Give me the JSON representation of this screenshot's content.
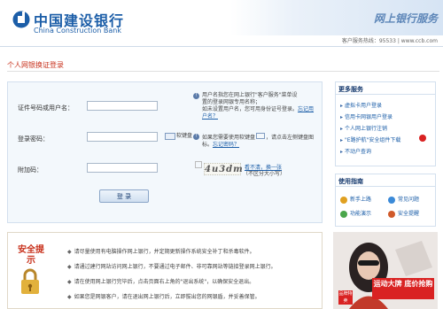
{
  "header": {
    "logo_cn": "中国建设银行",
    "logo_en": "China Construction Bank",
    "banner_title": "网上银行服务",
    "hotline": "客户服务热线：95533  |  www.ccb.com"
  },
  "page_title": "个人网银换证登录",
  "login": {
    "username_label": "证件号码或用户名：",
    "username_value": "",
    "password_label": "登录密码：",
    "password_value": "",
    "captcha_label": "附加码：",
    "captcha_value": "",
    "captcha_image_text": "4u3dm",
    "captcha_refresh_link": "看不清，换一张",
    "captcha_case_note": "（不区分大小写）",
    "keyboard_label": "软键盘",
    "username_hint_1": "用户名指您在网上银行\"客户服务\"菜单设",
    "username_hint_2": "置的登录网银专用名称；",
    "username_hint_3": "如未设置用户名，您可用身份证号登录。",
    "username_hint_link": "忘记用户名？",
    "password_hint_1": "如果您需要使用软键盘",
    "password_hint_2": "，请点击左侧键盘图标。",
    "password_hint_link": "忘记密码？",
    "login_button": "登 录"
  },
  "more_services": {
    "title": "更多服务",
    "items": [
      "虚拟卡用户登录",
      "信用卡网银用户登录",
      "个人网上银行注销",
      "\"E路护航\"安全组件下载",
      "不动户查询"
    ]
  },
  "guide": {
    "title": "使用指南",
    "items": [
      "新手上路",
      "常见问题",
      "功能演示",
      "安全提醒"
    ]
  },
  "security": {
    "title": "安全提示",
    "tips": [
      "请尽量使用有电脑操作网上银行，并定期更新操作系统安全补丁和杀毒软件。",
      "请通过建行网站访问网上银行，不要通过电子邮件、非可靠网站等链接登录网上银行。",
      "请在使用网上银行完毕后，点击页面右上角的\"退出系统\"，以确保安全退出。",
      "如果您是网银客户，请在退出网上银行后，立即拔出您的网银盾，并妥善保管。"
    ]
  },
  "ad": {
    "badge": "品牌特卖",
    "text": "运动大牌 底价抢购"
  },
  "colors": {
    "brand_blue": "#1c5ea8",
    "accent_red": "#c8321d",
    "panel_bg": "#f3f8fc"
  }
}
